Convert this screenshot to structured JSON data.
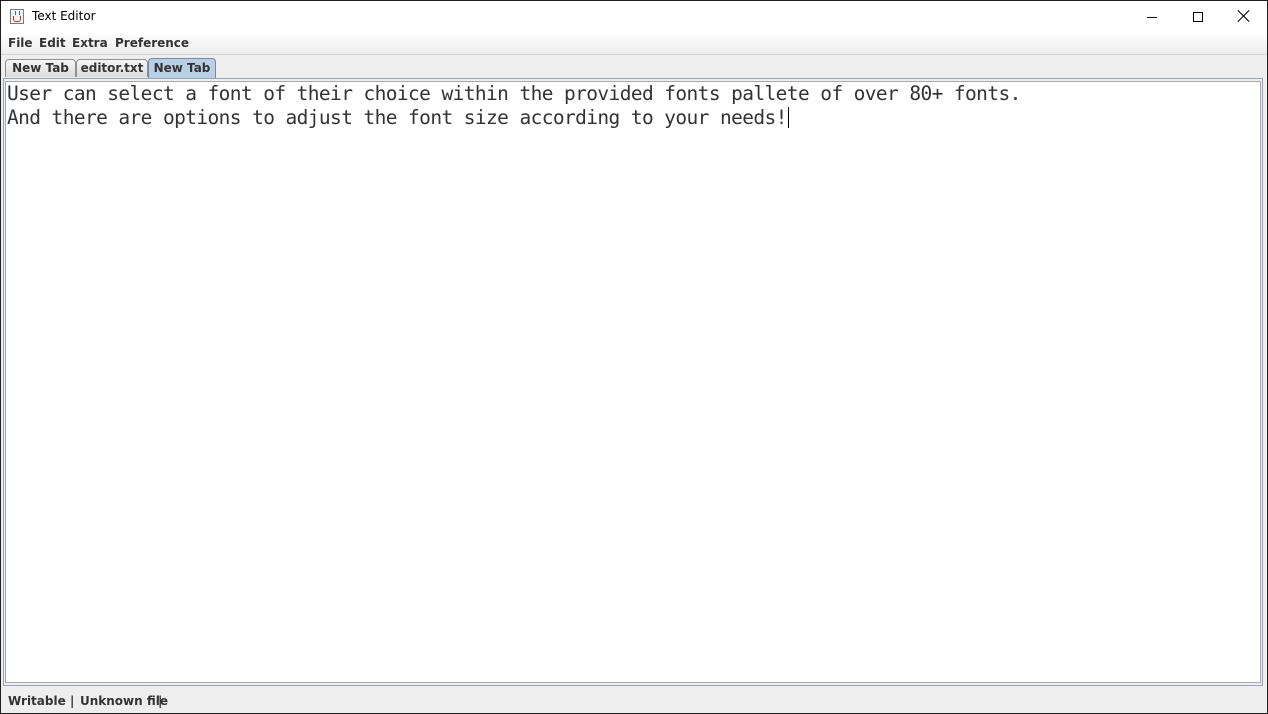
{
  "window": {
    "title": "Text Editor",
    "icon": "java-cup-icon",
    "controls": [
      "minimize-icon",
      "maximize-icon",
      "close-icon"
    ]
  },
  "menubar": {
    "items": [
      {
        "label": "File"
      },
      {
        "label": "Edit"
      },
      {
        "label": "Extra"
      },
      {
        "label": "Preference"
      }
    ]
  },
  "tabs": [
    {
      "label": "New Tab",
      "selected": false
    },
    {
      "label": "editor.txt",
      "selected": false
    },
    {
      "label": "New Tab",
      "selected": true
    }
  ],
  "editor": {
    "lines": [
      "User can select a font of their choice within the provided fonts pallete of over 80+ fonts.",
      "And there are options to adjust the font size according to your needs!"
    ]
  },
  "statusbar": {
    "mode": "Writable",
    "separator": "|",
    "file": "Unknown file"
  },
  "colors": {
    "selected_tab": "#b8cfe5",
    "text": "#333333",
    "editor_background": "#ffffff"
  }
}
